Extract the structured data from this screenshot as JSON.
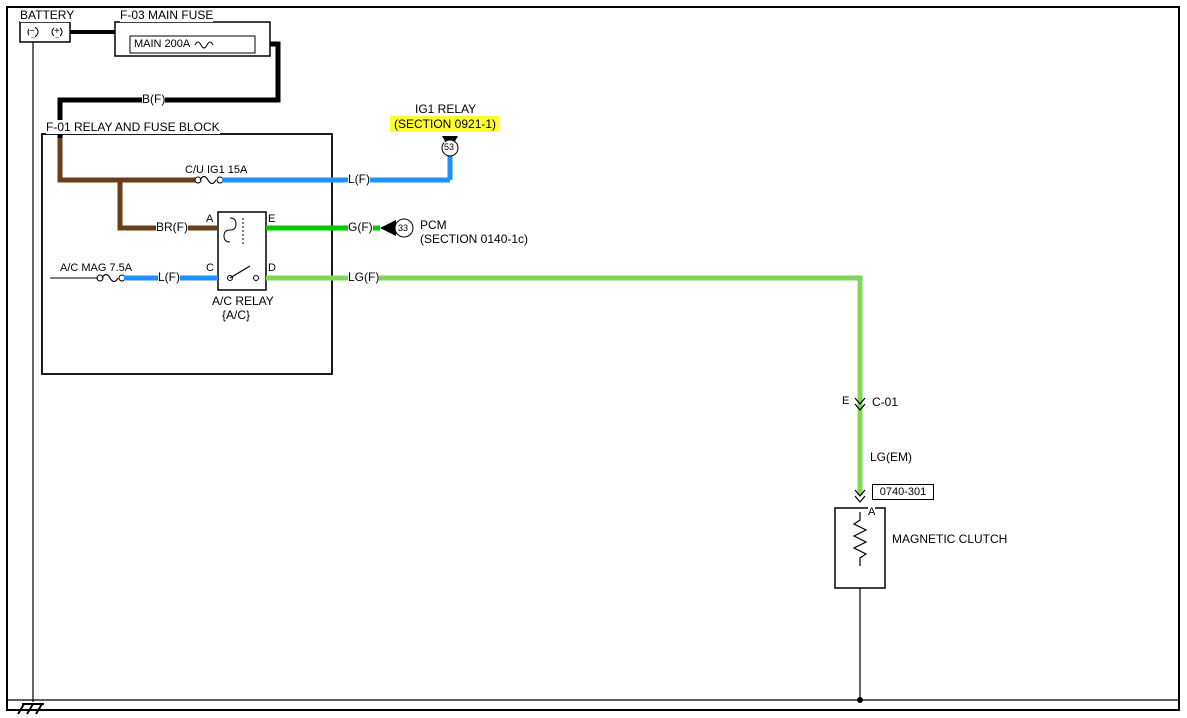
{
  "labels": {
    "battery": "BATTERY",
    "f03": "F-03  MAIN FUSE",
    "main200a": "MAIN 200A",
    "bf": "B(F)",
    "f01": "F-01 RELAY AND FUSE BLOCK",
    "cuig1": "C/U IG1 15A",
    "lf1": "L(F)",
    "ig1relay": "IG1 RELAY",
    "sec0921": "(SECTION 0921-1)",
    "pin53": "53",
    "brf": "BR(F)",
    "pinA": "A",
    "pinE": "E",
    "gf": "G(F)",
    "pin33": "33",
    "pcm": "PCM",
    "sec0140": "(SECTION 0140-1c)",
    "acmag": "A/C MAG 7.5A",
    "lf2": "L(F)",
    "pinC": "C",
    "pinD": "D",
    "lgf": "LG(F)",
    "acrelay": "A/C RELAY",
    "acrelay2": "{A/C}",
    "pinE2": "E",
    "c01": "C-01",
    "lgem": "LG(EM)",
    "ref0740": "0740-301",
    "pinA2": "A",
    "magclutch": "MAGNETIC CLUTCH",
    "batneg": "−",
    "batpos": "+"
  },
  "colors": {
    "blue": "#1e90ff",
    "green": "#00cc00",
    "lightgreen": "#7ed957",
    "brown": "#6b3e1a",
    "black": "#000000"
  }
}
